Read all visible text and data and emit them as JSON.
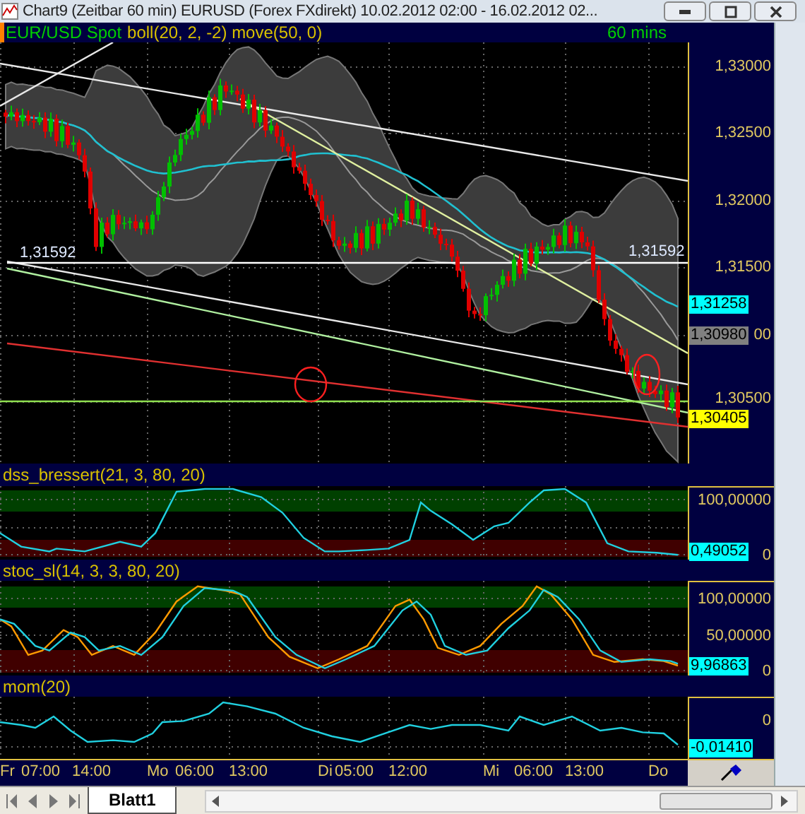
{
  "window": {
    "title": "Chart9 (Zeitbar 60 min)  EURUSD (Forex FXdirekt) 10.02.2012 02:00 - 16.02.2012 02..."
  },
  "chart": {
    "symbol": "EUR/USD Spot",
    "studies": "boll(20, 2, -2) move(50, 0)",
    "timeframe": "60 mins",
    "price_ticks": [
      "1,33000",
      "1,32500",
      "1,32000",
      "1,31500",
      "00",
      "1,30500"
    ],
    "price_markers": [
      {
        "text": "1,31258",
        "color": "#00ffff"
      },
      {
        "text": "1,30980",
        "color": "#808080"
      },
      {
        "text": "1,30405",
        "color": "#ffff00"
      }
    ],
    "level_labels": [
      "1,31592",
      "1,31592"
    ]
  },
  "panes": [
    {
      "title": "dss_bressert(21, 3, 80, 20)",
      "ticks": [
        "100,00000",
        "0"
      ],
      "value": "0,49052"
    },
    {
      "title": "stoc_sl(14, 3, 3, 80, 20)",
      "ticks": [
        "100,00000",
        "50,00000",
        "0"
      ],
      "value": "9,96863"
    },
    {
      "title": "mom(20)",
      "ticks": [
        "0"
      ],
      "value": "-0,01410"
    }
  ],
  "time_axis": [
    "Fr",
    "07:00",
    "14:00",
    "Mo",
    "06:00",
    "13:00",
    "Di",
    "05:00",
    "12:00",
    "Mi",
    "06:00",
    "13:00",
    "Do"
  ],
  "sheet_tabs": [
    {
      "label": "Blatt1",
      "selected": true
    }
  ]
}
